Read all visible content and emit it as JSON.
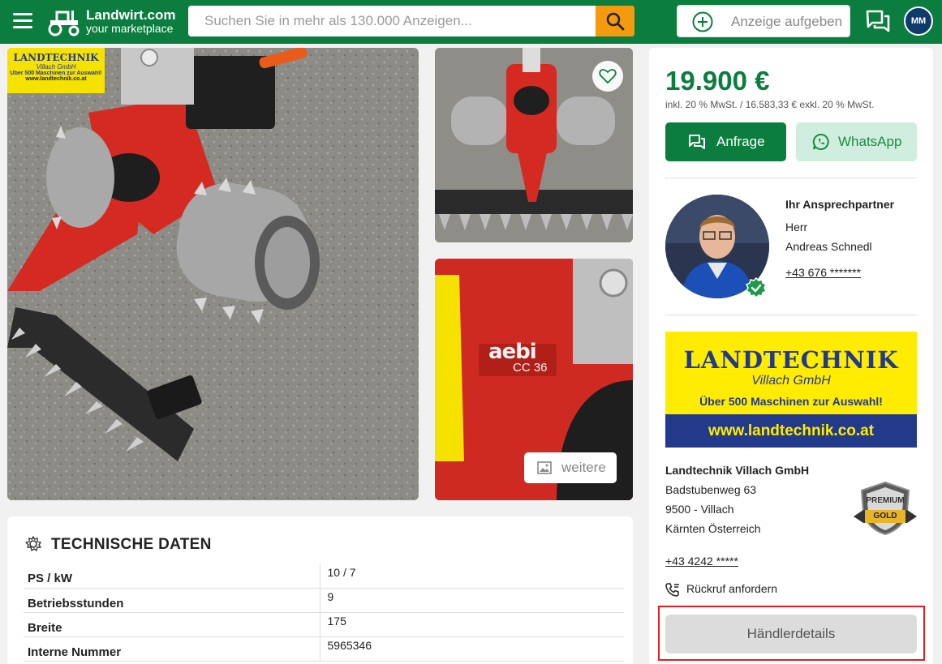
{
  "header": {
    "brand": "Landwirt.com",
    "tagline": "your marketplace",
    "search_placeholder": "Suchen Sie in mehr als 130.000 Anzeigen...",
    "post_ad_label": "Anzeige aufgeben",
    "user_initials": "MM",
    "brand_color": "#0b7d3e",
    "search_button_color": "#f39a0e"
  },
  "gallery": {
    "main_watermark": {
      "title": "LANDTECHNIK",
      "subtitle": "Villach GmbH",
      "claim": "Über 500 Maschinen zur Auswahl!",
      "url": "www.landtechnik.co.at"
    },
    "product_logo": "aebi",
    "product_model": "CC 36",
    "more_label": "weitere"
  },
  "tech": {
    "title": "TECHNISCHE DATEN",
    "rows": [
      {
        "key": "PS / kW",
        "value": "10 / 7"
      },
      {
        "key": "Betriebsstunden",
        "value": "9"
      },
      {
        "key": "Breite",
        "value": "175"
      },
      {
        "key": "Interne Nummer",
        "value": "5965346"
      }
    ]
  },
  "sidebar": {
    "price": "19.900 €",
    "price_note": "inkl. 20 % MwSt. / 16.583,33 € exkl. 20 % MwSt.",
    "anfrage_label": "Anfrage",
    "whatsapp_label": "WhatsApp",
    "contact": {
      "heading": "Ihr Ansprechpartner",
      "salutation": "Herr",
      "name": "Andreas Schnedl",
      "phone": "+43 676 *******"
    },
    "dealer_banner": {
      "title": "LANDTECHNIK",
      "subtitle": "Villach GmbH",
      "claim": "Über 500 Maschinen zur Auswahl!",
      "url": "www.landtechnik.co.at"
    },
    "dealer": {
      "name": "Landtechnik Villach GmbH",
      "street": "Badstubenweg 63",
      "city": "9500 - Villach",
      "region": "Kärnten Österreich",
      "phone": "+43 4242 *****",
      "badge_top": "PREMIUM",
      "badge_bottom": "GOLD"
    },
    "callback_label": "Rückruf anfordern",
    "dealer_details_label": "Händlerdetails"
  }
}
